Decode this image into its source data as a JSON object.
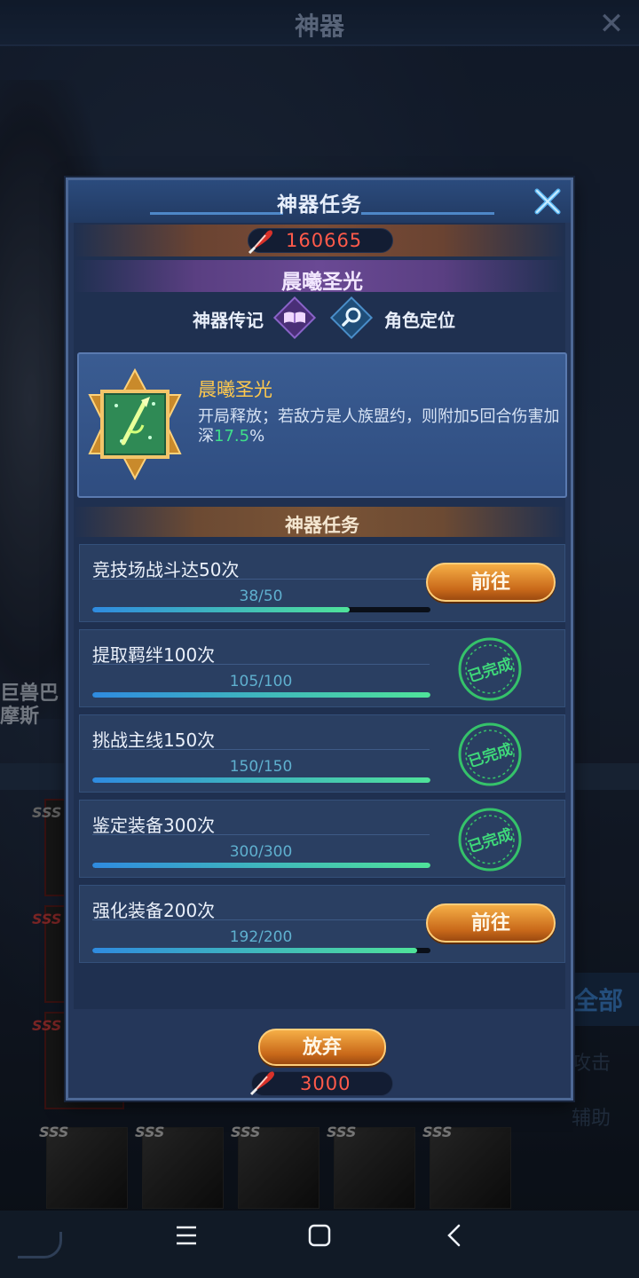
{
  "background": {
    "title": "神器",
    "hero_name": "巨兽巴摩斯",
    "side_button": "全部",
    "side_labels": [
      "攻击",
      "辅助"
    ],
    "badge": "SSS"
  },
  "modal": {
    "title": "神器任务",
    "power_value": "160665",
    "artifact_name": "晨曦圣光",
    "tabs": [
      {
        "label": "神器传记",
        "icon": "book-icon"
      },
      {
        "label": "角色定位",
        "icon": "magnifier-icon"
      }
    ],
    "artifact": {
      "name": "晨曦圣光",
      "desc_prefix": "开局释放；若敌方是人族盟约，则附加5回合伤害加深",
      "desc_value": "17.5",
      "desc_suffix": "%"
    },
    "tasks_title": "神器任务",
    "tasks": [
      {
        "label": "竞技场战斗达50次",
        "progress": "38/50",
        "fraction": 0.76,
        "status": "go",
        "action": "前往"
      },
      {
        "label": "提取羁绊100次",
        "progress": "105/100",
        "fraction": 1.0,
        "status": "done",
        "stamp": "已完成"
      },
      {
        "label": "挑战主线150次",
        "progress": "150/150",
        "fraction": 1.0,
        "status": "done",
        "stamp": "已完成"
      },
      {
        "label": "鉴定装备300次",
        "progress": "300/300",
        "fraction": 1.0,
        "status": "done",
        "stamp": "已完成"
      },
      {
        "label": "强化装备200次",
        "progress": "192/200",
        "fraction": 0.96,
        "status": "go",
        "action": "前往"
      }
    ],
    "abandon_label": "放弃",
    "abandon_cost": "3000"
  },
  "navbar": {
    "icons": [
      "menu-icon",
      "home-square-icon",
      "back-chevron-icon"
    ]
  },
  "colors": {
    "accent_orange": "#e08a2a",
    "power_red": "#ff5a4a",
    "highlight_green": "#3fe08a",
    "stamp_green": "#35c26a",
    "title_gold": "#ffc94d"
  }
}
